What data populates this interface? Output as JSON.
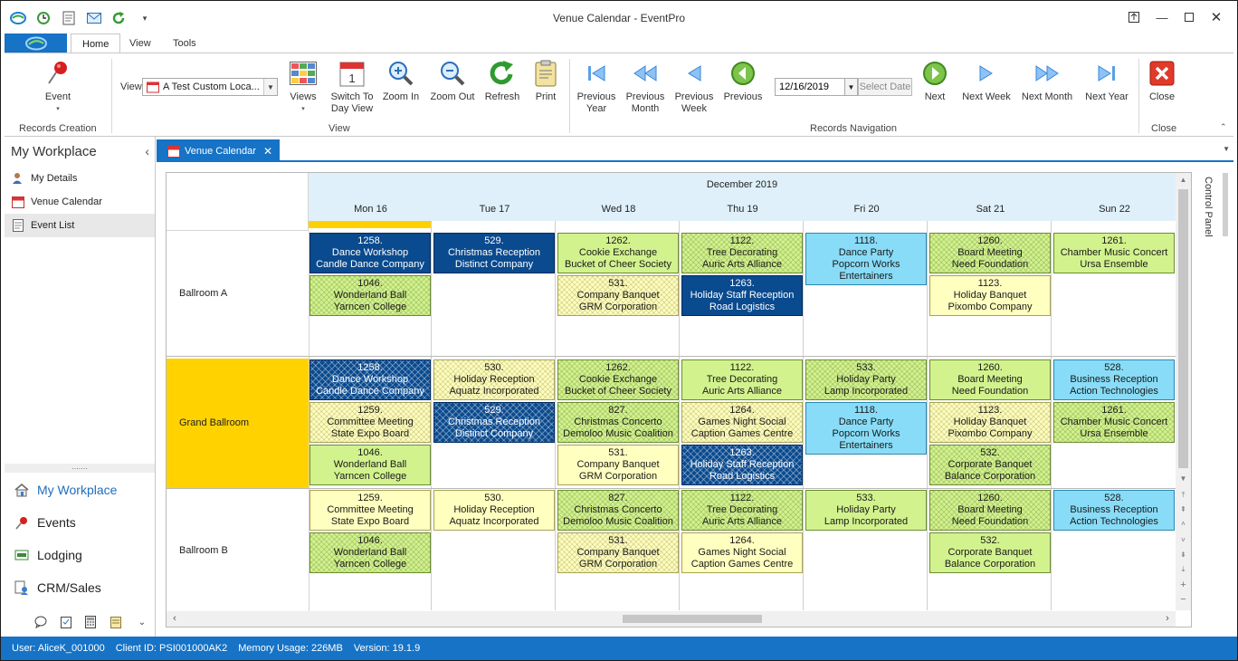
{
  "window": {
    "title": "Venue Calendar - EventPro"
  },
  "ribbon": {
    "tabs": [
      "Home",
      "View",
      "Tools"
    ],
    "event_label": "Event",
    "records_creation_label": "Records Creation",
    "view_label": "View",
    "view_value": "A Test Custom Loca...",
    "views_label": "Views",
    "switch_label_1": "Switch To",
    "switch_label_2": "Day View",
    "zoom_in_label": "Zoom In",
    "zoom_out_label": "Zoom Out",
    "refresh_label": "Refresh",
    "print_label": "Print",
    "view_group_label": "View",
    "prev_year_1": "Previous",
    "prev_year_2": "Year",
    "prev_month_1": "Previous",
    "prev_month_2": "Month",
    "prev_week_1": "Previous",
    "prev_week_2": "Week",
    "previous_label": "Previous",
    "date_value": "12/16/2019",
    "select_date_label": "Select Date",
    "next_label": "Next",
    "next_week_label": "Next Week",
    "next_month_label": "Next Month",
    "next_year_label": "Next Year",
    "records_nav_label": "Records Navigation",
    "close_label": "Close",
    "close_group_label": "Close"
  },
  "nav": {
    "title": "My Workplace",
    "items": [
      "My Details",
      "Venue Calendar",
      "Event List"
    ],
    "modules": [
      "My Workplace",
      "Events",
      "Lodging",
      "CRM/Sales"
    ]
  },
  "doc_tab": {
    "label": "Venue Calendar"
  },
  "calendar": {
    "month": "December 2019",
    "days": [
      "Mon 16",
      "Tue 17",
      "Wed 18",
      "Thu 19",
      "Fri 20",
      "Sat 21",
      "Sun 22"
    ],
    "resources": [
      "Ballroom A",
      "Grand Ballroom",
      "Ballroom B"
    ],
    "control_panel_label": "Control Panel",
    "appointments": [
      {
        "res": 0,
        "day": 0,
        "slot": 0,
        "lines": [
          "1258.",
          "Dance Workshop",
          "Candle Dance Company"
        ],
        "style": "c-blue"
      },
      {
        "res": 0,
        "day": 1,
        "slot": 0,
        "lines": [
          "529.",
          "Christmas Reception",
          "Distinct Company"
        ],
        "style": "c-blue"
      },
      {
        "res": 0,
        "day": 2,
        "slot": 0,
        "lines": [
          "1262.",
          "Cookie Exchange",
          "Bucket of Cheer Society"
        ],
        "style": "c-green"
      },
      {
        "res": 0,
        "day": 3,
        "slot": 0,
        "lines": [
          "1122.",
          "Tree Decorating",
          "Auric Arts Alliance"
        ],
        "style": "h-green"
      },
      {
        "res": 0,
        "day": 4,
        "slot": 0,
        "lines": [
          "1118.",
          "Dance Party",
          "Popcorn Works",
          "Entertainers"
        ],
        "style": "c-cyan"
      },
      {
        "res": 0,
        "day": 5,
        "slot": 0,
        "lines": [
          "1260.",
          "Board Meeting",
          "Need Foundation"
        ],
        "style": "h-green"
      },
      {
        "res": 0,
        "day": 6,
        "slot": 0,
        "lines": [
          "1261.",
          "Chamber Music Concert",
          "Ursa Ensemble"
        ],
        "style": "c-green"
      },
      {
        "res": 0,
        "day": 0,
        "slot": 1,
        "lines": [
          "1046.",
          "Wonderland Ball",
          "Yarncen College"
        ],
        "style": "h-green"
      },
      {
        "res": 0,
        "day": 2,
        "slot": 1,
        "lines": [
          "531.",
          "Company Banquet",
          "GRM Corporation"
        ],
        "style": "h-yellow"
      },
      {
        "res": 0,
        "day": 3,
        "slot": 1,
        "lines": [
          "1263.",
          "Holiday Staff Reception",
          "Road Logistics"
        ],
        "style": "c-blue"
      },
      {
        "res": 0,
        "day": 5,
        "slot": 1,
        "lines": [
          "1123.",
          "Holiday Banquet",
          "Pixombo Company"
        ],
        "style": "c-yellow"
      },
      {
        "res": 1,
        "day": 0,
        "slot": 0,
        "lines": [
          "1258.",
          "Dance Workshop",
          "Candle Dance Company"
        ],
        "style": "h-blue"
      },
      {
        "res": 1,
        "day": 1,
        "slot": 0,
        "lines": [
          "530.",
          "Holiday Reception",
          "Aquatz Incorporated"
        ],
        "style": "h-yellow"
      },
      {
        "res": 1,
        "day": 2,
        "slot": 0,
        "lines": [
          "1262.",
          "Cookie Exchange",
          "Bucket of Cheer Society"
        ],
        "style": "h-green"
      },
      {
        "res": 1,
        "day": 3,
        "slot": 0,
        "lines": [
          "1122.",
          "Tree Decorating",
          "Auric Arts Alliance"
        ],
        "style": "c-green"
      },
      {
        "res": 1,
        "day": 4,
        "slot": 0,
        "lines": [
          "533.",
          "Holiday Party",
          "Lamp Incorporated"
        ],
        "style": "h-green"
      },
      {
        "res": 1,
        "day": 5,
        "slot": 0,
        "lines": [
          "1260.",
          "Board Meeting",
          "Need Foundation"
        ],
        "style": "c-green"
      },
      {
        "res": 1,
        "day": 6,
        "slot": 0,
        "lines": [
          "528.",
          "Business Reception",
          "Action Technologies"
        ],
        "style": "c-cyan"
      },
      {
        "res": 1,
        "day": 0,
        "slot": 1,
        "lines": [
          "1259.",
          "Committee Meeting",
          "State Expo Board"
        ],
        "style": "h-yellow"
      },
      {
        "res": 1,
        "day": 1,
        "slot": 1,
        "lines": [
          "529.",
          "Christmas Reception",
          "Distinct Company"
        ],
        "style": "h-blue"
      },
      {
        "res": 1,
        "day": 2,
        "slot": 1,
        "lines": [
          "827.",
          "Christmas Concerto",
          "Demoloo Music Coalition"
        ],
        "style": "h-green"
      },
      {
        "res": 1,
        "day": 3,
        "slot": 1,
        "lines": [
          "1264.",
          "Games Night Social",
          "Caption Games Centre"
        ],
        "style": "h-yellow"
      },
      {
        "res": 1,
        "day": 4,
        "slot": 1,
        "lines": [
          "1118.",
          "Dance Party",
          "Popcorn Works",
          "Entertainers"
        ],
        "style": "c-cyan"
      },
      {
        "res": 1,
        "day": 5,
        "slot": 1,
        "lines": [
          "1123.",
          "Holiday Banquet",
          "Pixombo Company"
        ],
        "style": "h-yellow"
      },
      {
        "res": 1,
        "day": 6,
        "slot": 1,
        "lines": [
          "1261.",
          "Chamber Music Concert",
          "Ursa Ensemble"
        ],
        "style": "h-green"
      },
      {
        "res": 1,
        "day": 0,
        "slot": 2,
        "lines": [
          "1046.",
          "Wonderland Ball",
          "Yarncen College"
        ],
        "style": "c-green"
      },
      {
        "res": 1,
        "day": 2,
        "slot": 2,
        "lines": [
          "531.",
          "Company Banquet",
          "GRM Corporation"
        ],
        "style": "c-yellow"
      },
      {
        "res": 1,
        "day": 3,
        "slot": 2,
        "lines": [
          "1263.",
          "Holiday Staff Reception",
          "Road Logistics"
        ],
        "style": "h-blue"
      },
      {
        "res": 1,
        "day": 5,
        "slot": 2,
        "lines": [
          "532.",
          "Corporate Banquet",
          "Balance Corporation"
        ],
        "style": "h-green"
      },
      {
        "res": 2,
        "day": 0,
        "slot": 0,
        "lines": [
          "1259.",
          "Committee Meeting",
          "State Expo Board"
        ],
        "style": "c-yellow"
      },
      {
        "res": 2,
        "day": 1,
        "slot": 0,
        "lines": [
          "530.",
          "Holiday Reception",
          "Aquatz Incorporated"
        ],
        "style": "c-yellow"
      },
      {
        "res": 2,
        "day": 2,
        "slot": 0,
        "lines": [
          "827.",
          "Christmas Concerto",
          "Demoloo Music Coalition"
        ],
        "style": "h-green"
      },
      {
        "res": 2,
        "day": 3,
        "slot": 0,
        "lines": [
          "1122.",
          "Tree Decorating",
          "Auric Arts Alliance"
        ],
        "style": "h-green"
      },
      {
        "res": 2,
        "day": 4,
        "slot": 0,
        "lines": [
          "533.",
          "Holiday Party",
          "Lamp Incorporated"
        ],
        "style": "c-green"
      },
      {
        "res": 2,
        "day": 5,
        "slot": 0,
        "lines": [
          "1260.",
          "Board Meeting",
          "Need Foundation"
        ],
        "style": "h-green"
      },
      {
        "res": 2,
        "day": 6,
        "slot": 0,
        "lines": [
          "528.",
          "Business Reception",
          "Action Technologies"
        ],
        "style": "c-cyan"
      },
      {
        "res": 2,
        "day": 0,
        "slot": 1,
        "lines": [
          "1046.",
          "Wonderland Ball",
          "Yarncen College"
        ],
        "style": "h-green"
      },
      {
        "res": 2,
        "day": 2,
        "slot": 1,
        "lines": [
          "531.",
          "Company Banquet",
          "GRM Corporation"
        ],
        "style": "h-yellow"
      },
      {
        "res": 2,
        "day": 3,
        "slot": 1,
        "lines": [
          "1264.",
          "Games Night Social",
          "Caption Games Centre"
        ],
        "style": "c-yellow"
      },
      {
        "res": 2,
        "day": 5,
        "slot": 1,
        "lines": [
          "532.",
          "Corporate Banquet",
          "Balance Corporation"
        ],
        "style": "c-green"
      }
    ]
  },
  "status": {
    "user": "User: AliceK_001000",
    "client": "Client ID: PSI001000AK2",
    "memory": "Memory Usage: 226MB",
    "version": "Version: 19.1.9"
  },
  "colors": {
    "accent": "#1673c6",
    "today": "#ffd000",
    "appt_blue": "#0a4a8e",
    "appt_green": "#d2f28e",
    "appt_yellow": "#ffffc0",
    "appt_cyan": "#88dcf7"
  }
}
